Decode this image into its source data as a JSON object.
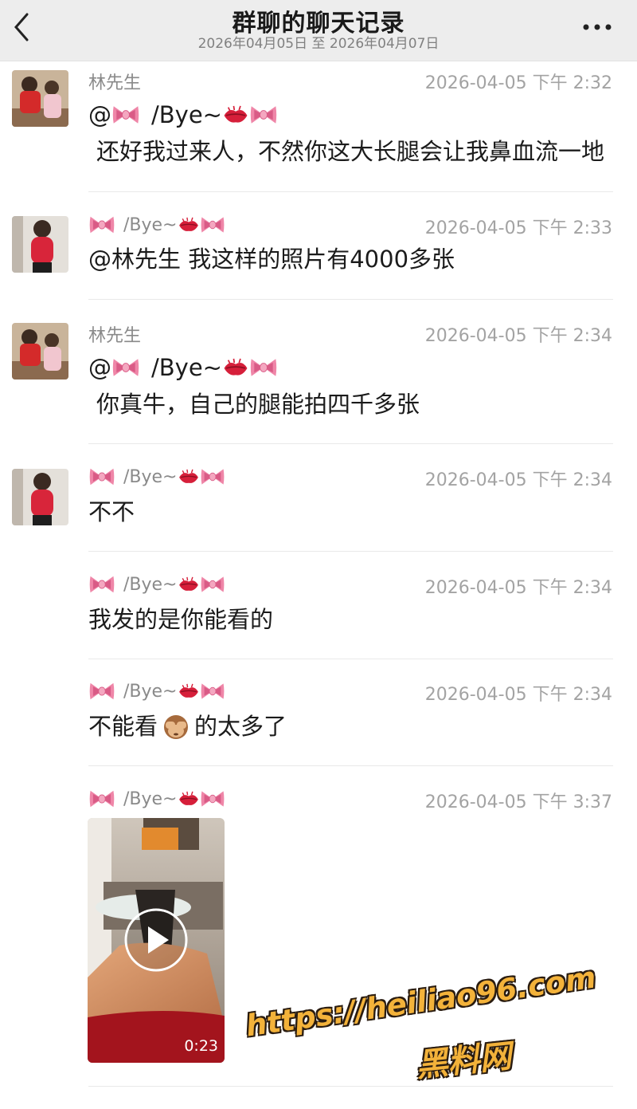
{
  "header": {
    "title": "群聊的聊天记录",
    "date_range": "2026年04月05日 至 2026年04月07日"
  },
  "names": {
    "lin": "林先生",
    "bye": "/Bye~"
  },
  "messages": [
    {
      "text": "还好我过来人，不然你这大长腿会让我鼻血流一地",
      "ts": "2026-04-05 下午 2:32",
      "mention": "@"
    },
    {
      "text": "@林先生 我这样的照片有4000多张",
      "ts": "2026-04-05 下午 2:33"
    },
    {
      "text": "你真牛，自己的腿能拍四千多张",
      "ts": "2026-04-05 下午 2:34",
      "mention": "@"
    },
    {
      "text": "不不",
      "ts": "2026-04-05 下午 2:34"
    },
    {
      "text": "我发的是你能看的",
      "ts": "2026-04-05 下午 2:34"
    },
    {
      "text_a": "不能看",
      "text_b": "的太多了",
      "ts": "2026-04-05 下午 2:34"
    },
    {
      "ts": "2026-04-05 下午 3:37",
      "video_duration": "0:23"
    }
  ],
  "watermark": {
    "url": "https://heiliao96.com",
    "name": "黑料网"
  },
  "colors": {
    "header_bg": "#ededed",
    "timestamp": "#a3a3a3",
    "sender": "#8a8a8a",
    "bow": "#e8749a",
    "lips": "#d61f3a",
    "watermark": "#f3b23a"
  },
  "icons": [
    "back-chevron-icon",
    "more-dots-icon",
    "bow-icon",
    "lips-icon",
    "see-no-evil-monkey-icon",
    "play-icon"
  ]
}
